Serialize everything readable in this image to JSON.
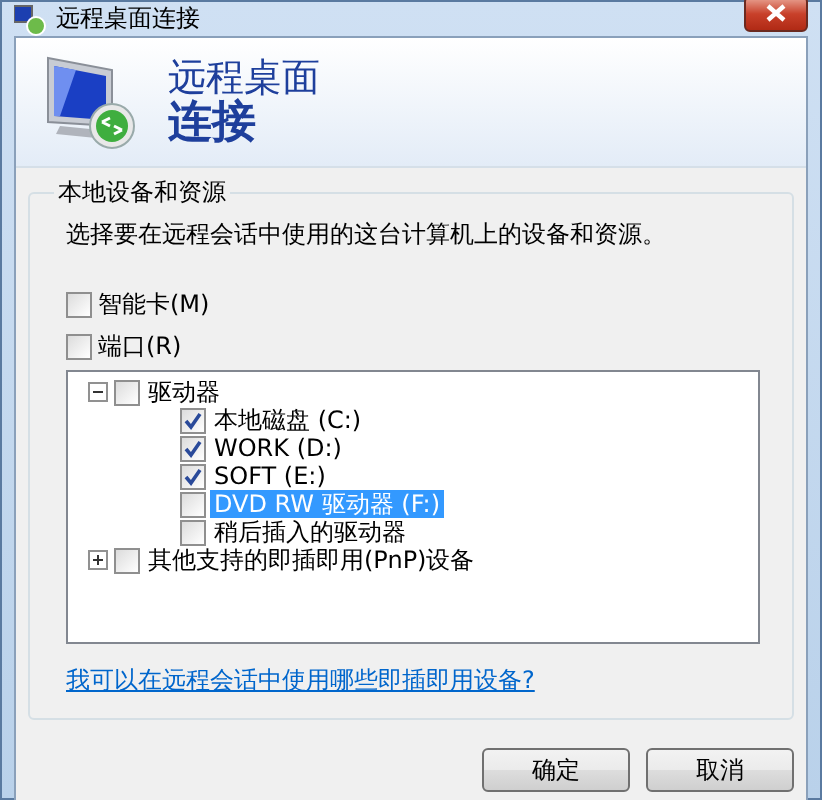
{
  "window": {
    "title": "远程桌面连接"
  },
  "header": {
    "line_1": "远程桌面",
    "line_2": "连接"
  },
  "group": {
    "title": "本地设备和资源",
    "description": "选择要在远程会话中使用的这台计算机上的设备和资源。"
  },
  "options": [
    {
      "label": "智能卡(M)",
      "checked": false
    },
    {
      "label": "端口(R)",
      "checked": false
    }
  ],
  "tree": [
    {
      "label": "驱动器",
      "checked": false,
      "selected": false,
      "expanded": true,
      "children": [
        {
          "label": "本地磁盘 (C:)",
          "checked": true,
          "selected": false
        },
        {
          "label": "WORK (D:)",
          "checked": true,
          "selected": false
        },
        {
          "label": "SOFT (E:)",
          "checked": true,
          "selected": false
        },
        {
          "label": "DVD RW 驱动器 (F:)",
          "checked": false,
          "selected": true
        },
        {
          "label": "稍后插入的驱动器",
          "checked": false,
          "selected": false
        }
      ]
    },
    {
      "label": "其他支持的即插即用(PnP)设备",
      "checked": false,
      "selected": false,
      "expanded": false
    }
  ],
  "link": "我可以在远程会话中使用哪些即插即用设备?",
  "buttons": [
    "确定",
    "取消"
  ]
}
